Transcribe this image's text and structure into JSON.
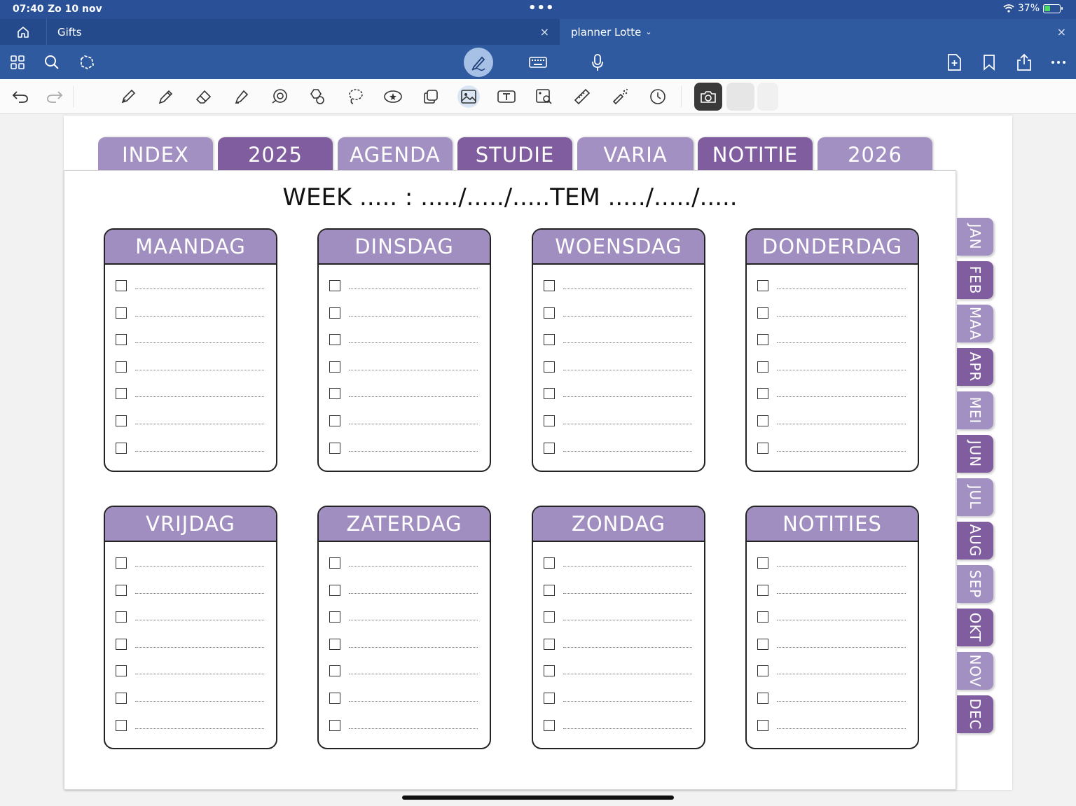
{
  "status": {
    "time": "07:40",
    "date": "Zo 10 nov",
    "battery": "37%"
  },
  "tabs": {
    "gifts": "Gifts",
    "planner": "planner Lotte",
    "close": "×"
  },
  "sections": [
    "INDEX",
    "2025",
    "AGENDA",
    "STUDIE",
    "VARIA",
    "NOTITIE",
    "2026"
  ],
  "week_line": "WEEK ..... : ...../...../.....TEM ...../...../.....",
  "days": [
    "MAANDAG",
    "DINSDAG",
    "WOENSDAG",
    "DONDERDAG",
    "VRIJDAG",
    "ZATERDAG",
    "ZONDAG",
    "NOTITIES"
  ],
  "months": [
    "JAN",
    "FEB",
    "MAA",
    "APR",
    "MEI",
    "JUN",
    "JUL",
    "AUG",
    "SEP",
    "OKT",
    "NOV",
    "DEC"
  ],
  "colors": {
    "tab_light": "#a390c2",
    "tab_dark": "#7f5d9e",
    "header": "#9f8ebf",
    "app_blue": "#2f5aa0"
  }
}
